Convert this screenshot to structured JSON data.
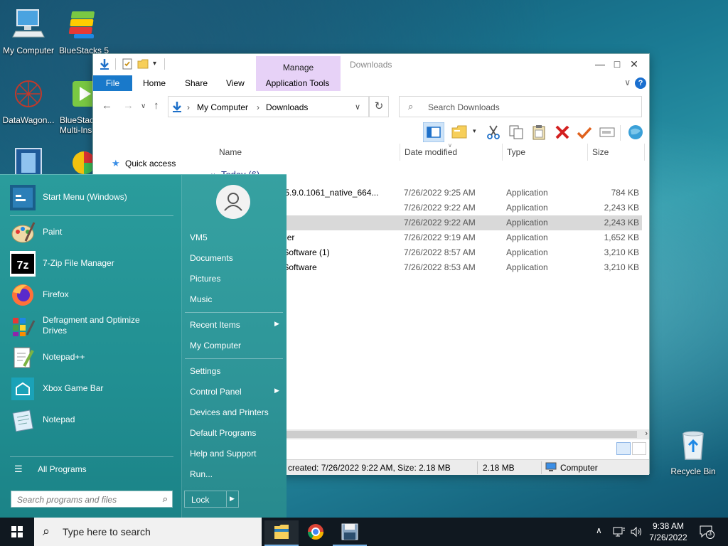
{
  "desktop": {
    "icons": [
      {
        "label": "My Computer"
      },
      {
        "label": "BlueStacks 5"
      },
      {
        "label": "DataWagon..."
      },
      {
        "label": "BlueStac",
        "label2": "Multi-Ins"
      },
      {
        "label": "Recycle Bin"
      }
    ]
  },
  "explorer": {
    "title": "Downloads",
    "manage_label": "Manage",
    "tabs": [
      "File",
      "Home",
      "Share",
      "View",
      "Application Tools"
    ],
    "address": {
      "root": "My Computer",
      "current": "Downloads"
    },
    "search_placeholder": "Search Downloads",
    "nav_pane": {
      "quick_access": "Quick access"
    },
    "columns": [
      "Name",
      "Date modified",
      "Type",
      "Size"
    ],
    "group_label": "Today (6)",
    "files": [
      {
        "name": "aller_5.9.0.1061_native_664...",
        "date": "7/26/2022 9:25 AM",
        "type": "Application",
        "size": "784 KB",
        "selected": false
      },
      {
        "name": ")",
        "date": "7/26/2022 9:22 AM",
        "type": "Application",
        "size": "2,243 KB",
        "selected": false
      },
      {
        "name": "",
        "date": "7/26/2022 9:22 AM",
        "type": "Application",
        "size": "2,243 KB",
        "selected": true
      },
      {
        "name": "auncher",
        "date": "7/26/2022 9:19 AM",
        "type": "Application",
        "size": "1,652 KB",
        "selected": false
      },
      {
        "name": "ptureSoftware (1)",
        "date": "7/26/2022 8:57 AM",
        "type": "Application",
        "size": "3,210 KB",
        "selected": false
      },
      {
        "name": "ptureSoftware",
        "date": "7/26/2022 8:53 AM",
        "type": "Application",
        "size": "3,210 KB",
        "selected": false
      }
    ],
    "status": {
      "info": "created: 7/26/2022 9:22 AM, Size: 2.18 MB",
      "size": "2.18 MB",
      "location": "Computer"
    }
  },
  "start_menu": {
    "pinned_top": "Start Menu (Windows)",
    "programs": [
      {
        "label": "Paint"
      },
      {
        "label": "7-Zip File Manager"
      },
      {
        "label": "Firefox"
      },
      {
        "label": "Defragment and Optimize Drives"
      },
      {
        "label": "Notepad++"
      },
      {
        "label": "Xbox Game Bar"
      },
      {
        "label": "Notepad"
      }
    ],
    "all_programs": "All Programs",
    "search_placeholder": "Search programs and files",
    "right": {
      "user": "VM5",
      "items": [
        "Documents",
        "Pictures",
        "Music"
      ],
      "recent_items": "Recent Items",
      "my_computer": "My Computer",
      "settings": "Settings",
      "control_panel": "Control Panel",
      "devices": "Devices and Printers",
      "default_programs": "Default Programs",
      "help": "Help and Support",
      "run": "Run...",
      "lock": "Lock"
    }
  },
  "taskbar": {
    "search_placeholder": "Type here to search",
    "time": "9:38 AM",
    "date": "7/26/2022",
    "notification_count": "3"
  }
}
